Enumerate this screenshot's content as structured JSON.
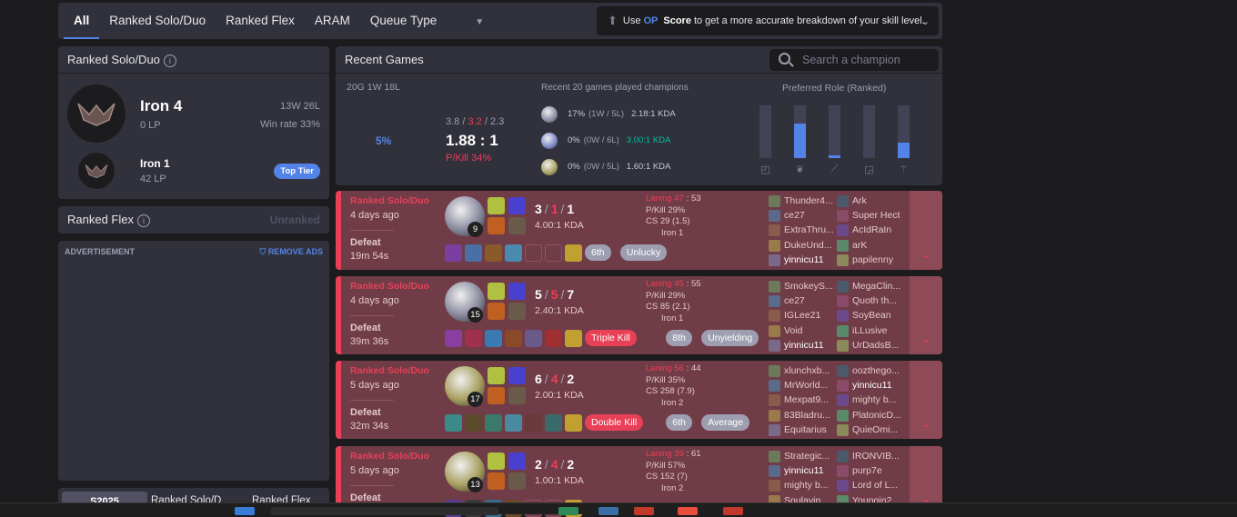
{
  "tabs": [
    "All",
    "Ranked Solo/Duo",
    "Ranked Flex",
    "ARAM",
    "Queue Type"
  ],
  "op_banner": {
    "pre": "Use",
    "brand": "OP",
    "score": "Score",
    "post": "to get a more accurate breakdown of your skill level."
  },
  "solo": {
    "title": "Ranked Solo/Duo",
    "tier": "Iron 4",
    "lp": "0 LP",
    "record": "13W 26L",
    "winrate": "Win rate 33%",
    "peak_tier": "Iron 1",
    "peak_lp": "42 LP",
    "peak_badge": "Top Tier"
  },
  "flex": {
    "title": "Ranked Flex",
    "status": "Unranked"
  },
  "ad": {
    "label": "ADVERTISEMENT",
    "remove": "REMOVE ADS"
  },
  "season": {
    "tag": "S2025",
    "a": "Ranked Solo/D",
    "b": "Ranked Flex"
  },
  "recent": {
    "title": "Recent Games",
    "search_placeholder": "Search a champion",
    "record": "20G 1W 18L",
    "winrate": "5%",
    "avg_k": "3.8",
    "avg_d": "3.2",
    "avg_a": "2.3",
    "kda": "1.88 : 1",
    "pkill": "P/Kill 34%",
    "champs_title": "Recent 20 games played champions",
    "champs": [
      {
        "pct": "17%",
        "wl": "(1W / 5L)",
        "kda": "2.18:1 KDA",
        "color": "#8a8aa0"
      },
      {
        "pct": "0%",
        "wl": "(0W / 6L)",
        "kda": "3.00:1 KDA",
        "color": "#7a86c8"
      },
      {
        "pct": "0%",
        "wl": "(0W / 5L)",
        "kda": "1.60:1 KDA",
        "color": "#a8a060"
      }
    ],
    "role_title": "Preferred Role (Ranked)",
    "roles": [
      {
        "name": "top-icon",
        "glyph": "◰",
        "fill": 0
      },
      {
        "name": "jungle-icon",
        "glyph": "❦",
        "fill": 0.65
      },
      {
        "name": "mid-icon",
        "glyph": "⟋",
        "fill": 0.05
      },
      {
        "name": "bottom-icon",
        "glyph": "◲",
        "fill": 0
      },
      {
        "name": "support-icon",
        "glyph": "⚚",
        "fill": 0.3
      }
    ],
    "kda_colors": {
      "good": "#00bba3",
      "red": "#e84057",
      "blue": "#5383e8"
    }
  },
  "games": [
    {
      "mode": "Ranked Solo/Duo",
      "ago": "4 days ago",
      "result": "Defeat",
      "duration": "19m 54s",
      "level": "9",
      "k": "3",
      "d": "1",
      "a": "1",
      "kda": "4.00:1 KDA",
      "laning": "Laning 47",
      "laning_b": ": 53",
      "pkill": "P/Kill 29%",
      "cs": "CS 29 (1.5)",
      "rank": "Iron 1",
      "badges": [
        {
          "t": "6th",
          "red": false
        },
        {
          "t": "Unlucky",
          "red": false
        }
      ],
      "champ_color": "#8a8aa0",
      "team1": [
        "Thunder4...",
        "ce27",
        "ExtraThru...",
        "DukeUnd...",
        "yinnicu11"
      ],
      "team2": [
        "Ark",
        "Super Hect",
        "AcIdRaIn",
        "arK",
        "papilenny"
      ]
    },
    {
      "mode": "Ranked Solo/Duo",
      "ago": "4 days ago",
      "result": "Defeat",
      "duration": "39m 36s",
      "level": "15",
      "k": "5",
      "d": "5",
      "a": "7",
      "kda": "2.40:1 KDA",
      "laning": "Laning 45",
      "laning_b": ": 55",
      "pkill": "P/Kill 29%",
      "cs": "CS 85 (2.1)",
      "rank": "Iron 1",
      "badges": [
        {
          "t": "Triple Kill",
          "red": true
        },
        {
          "t": "8th",
          "red": false
        },
        {
          "t": "Unyielding",
          "red": false
        }
      ],
      "champ_color": "#8a8aa0",
      "team1": [
        "SmokeyS...",
        "ce27",
        "IGLee21",
        "Void",
        "yinnicu11"
      ],
      "team2": [
        "MegaClin...",
        "Quoth th...",
        "SoyBean",
        "iLLusive",
        "UrDadsB..."
      ]
    },
    {
      "mode": "Ranked Solo/Duo",
      "ago": "5 days ago",
      "result": "Defeat",
      "duration": "32m 34s",
      "level": "17",
      "k": "6",
      "d": "4",
      "a": "2",
      "kda": "2.00:1 KDA",
      "laning": "Laning 56",
      "laning_b": ": 44",
      "pkill": "P/Kill 35%",
      "cs": "CS 258 (7.9)",
      "rank": "Iron 2",
      "badges": [
        {
          "t": "Double Kill",
          "red": true
        },
        {
          "t": "6th",
          "red": false
        },
        {
          "t": "Average",
          "red": false
        }
      ],
      "champ_color": "#a8a060",
      "team1": [
        "xlunchxb...",
        "MrWorld...",
        "Mexpat9...",
        "83Bladru...",
        "Equitarius"
      ],
      "team2": [
        "oozthego...",
        "yinnicu11",
        "mighty b...",
        "PlatonicD...",
        "QuieOmi..."
      ]
    },
    {
      "mode": "Ranked Solo/Duo",
      "ago": "5 days ago",
      "result": "Defeat",
      "duration": "",
      "level": "13",
      "k": "2",
      "d": "4",
      "a": "2",
      "kda": "1.00:1 KDA",
      "laning": "Laning 39",
      "laning_b": ": 61",
      "pkill": "P/Kill 57%",
      "cs": "CS 152 (7)",
      "rank": "Iron 2",
      "badges": [],
      "champ_color": "#a8a060",
      "team1": [
        "Strategic...",
        "yinnicu11",
        "mighty b...",
        "Soulavin..."
      ],
      "team2": [
        "IRONVIB...",
        "purp7e",
        "Lord of L...",
        "Youngin2..."
      ]
    }
  ],
  "player_name": "yinnicu11"
}
